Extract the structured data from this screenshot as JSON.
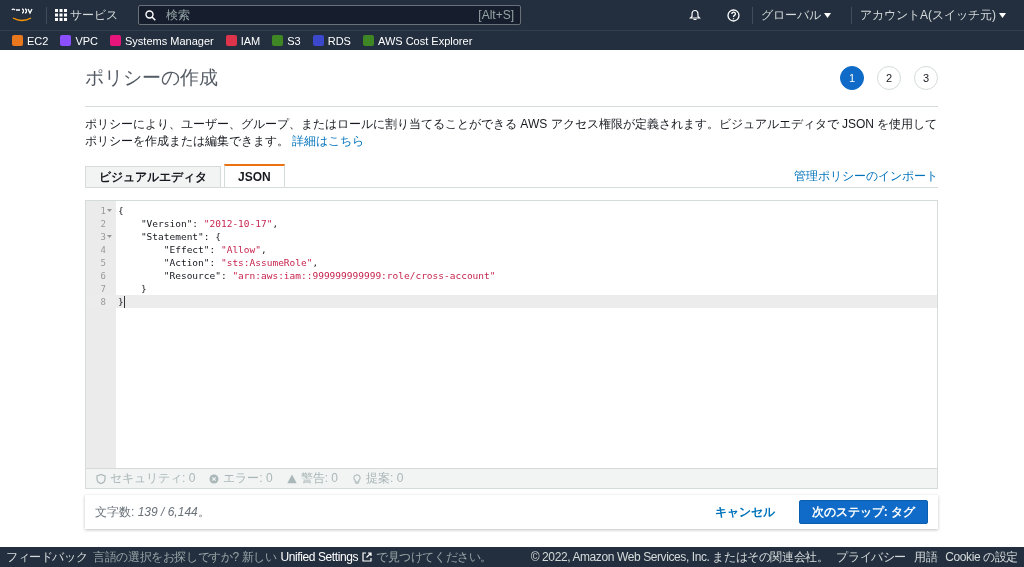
{
  "nav": {
    "services": "サービス",
    "search": {
      "placeholder": "検索",
      "shortcut": "[Alt+S]"
    },
    "region": "グローバル",
    "account": "アカウントA(スイッチ元)"
  },
  "favorites": [
    {
      "label": "EC2",
      "color": "#e8771e"
    },
    {
      "label": "VPC",
      "color": "#8c4fff"
    },
    {
      "label": "Systems Manager",
      "color": "#e7157b"
    },
    {
      "label": "IAM",
      "color": "#dd344c"
    },
    {
      "label": "S3",
      "color": "#3f8624"
    },
    {
      "label": "RDS",
      "color": "#3b48cc"
    },
    {
      "label": "AWS Cost Explorer",
      "color": "#3f8624"
    }
  ],
  "page": {
    "title": "ポリシーの作成",
    "steps": [
      {
        "label": "1",
        "selected": true
      },
      {
        "label": "2",
        "selected": false
      },
      {
        "label": "3",
        "selected": false
      }
    ],
    "description": "ポリシーにより、ユーザー、グループ、またはロールに割り当てることができる AWS アクセス権限が定義されます。ビジュアルエディタで JSON を使用してポリシーを作成または編集できます。",
    "details_link": "詳細はこちら"
  },
  "tabs": [
    {
      "label": "ビジュアルエディタ",
      "selected": false
    },
    {
      "label": "JSON",
      "selected": true
    }
  ],
  "import_link": "管理ポリシーのインポート",
  "editor": {
    "lines": [
      {
        "number": "1",
        "foldable": true,
        "active": false,
        "tokens": [
          {
            "kind": "punct",
            "text": "{"
          }
        ]
      },
      {
        "number": "2",
        "foldable": false,
        "active": false,
        "tokens": [
          {
            "kind": "punct",
            "text": "    \"Version\": "
          },
          {
            "kind": "string",
            "text": "\"2012-10-17\""
          },
          {
            "kind": "punct",
            "text": ","
          }
        ]
      },
      {
        "number": "3",
        "foldable": true,
        "active": false,
        "tokens": [
          {
            "kind": "punct",
            "text": "    \"Statement\": {"
          }
        ]
      },
      {
        "number": "4",
        "foldable": false,
        "active": false,
        "tokens": [
          {
            "kind": "punct",
            "text": "        \"Effect\": "
          },
          {
            "kind": "string",
            "text": "\"Allow\""
          },
          {
            "kind": "punct",
            "text": ","
          }
        ]
      },
      {
        "number": "5",
        "foldable": false,
        "active": false,
        "tokens": [
          {
            "kind": "punct",
            "text": "        \"Action\": "
          },
          {
            "kind": "string",
            "text": "\"sts:AssumeRole\""
          },
          {
            "kind": "punct",
            "text": ","
          }
        ]
      },
      {
        "number": "6",
        "foldable": false,
        "active": false,
        "tokens": [
          {
            "kind": "punct",
            "text": "        \"Resource\": "
          },
          {
            "kind": "string",
            "text": "\"arn:aws:iam::999999999999:role/cross-account\""
          }
        ]
      },
      {
        "number": "7",
        "foldable": false,
        "active": false,
        "tokens": [
          {
            "kind": "punct",
            "text": "    }"
          }
        ]
      },
      {
        "number": "8",
        "foldable": false,
        "active": true,
        "tokens": [
          {
            "kind": "punct",
            "text": "}"
          }
        ]
      }
    ],
    "status": [
      {
        "kind": "security",
        "label": "セキュリティ: 0"
      },
      {
        "kind": "error",
        "label": "エラー: 0"
      },
      {
        "kind": "warning",
        "label": "警告: 0"
      },
      {
        "kind": "suggestion",
        "label": "提案: 0"
      }
    ]
  },
  "footer_card": {
    "char_label": "文字数: ",
    "char_count": "139 / 6,144。",
    "cancel": "キャンセル",
    "next": "次のステップ: タグ"
  },
  "bottom_bar": {
    "feedback": "フィードバック",
    "lang_prefix": "言語の選択をお探しですか? 新しい",
    "unified": "Unified Settings",
    "lang_suffix": "で見つけてください。",
    "copyright": "© 2022, Amazon Web Services, Inc. またはその関連会社。",
    "links": [
      "プライバシー",
      "用語",
      "Cookie の設定"
    ]
  }
}
